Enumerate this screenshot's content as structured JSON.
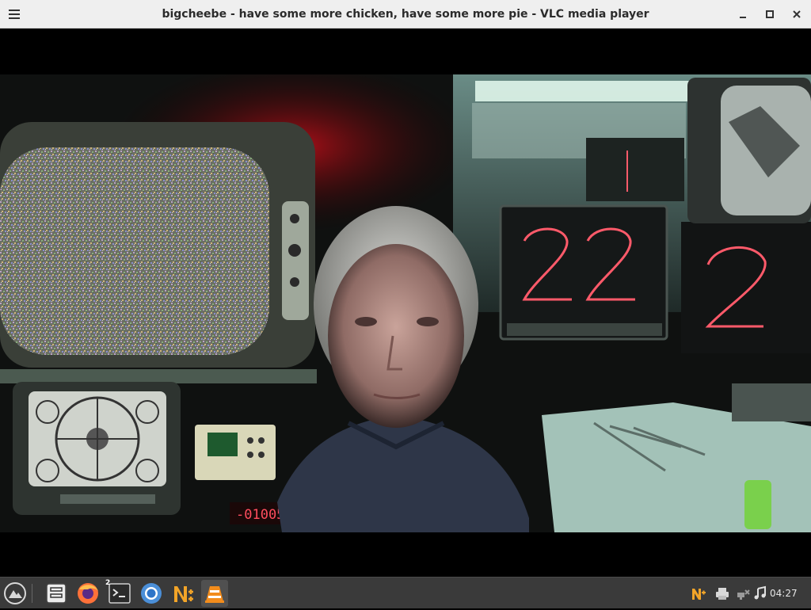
{
  "window": {
    "title": "bigcheebe - have some more chicken, have some more pie - VLC media player",
    "menu_icon": "hamburger-menu-icon",
    "controls": [
      "minimize-icon",
      "maximize-icon",
      "close-icon"
    ]
  },
  "video": {
    "overlay_counter": "-01005"
  },
  "taskbar": {
    "launcher_icon": "app-launcher-icon",
    "apps": [
      {
        "name": "files",
        "icon": "file-manager-icon"
      },
      {
        "name": "firefox",
        "icon": "firefox-icon"
      },
      {
        "name": "terminal",
        "icon": "terminal-icon",
        "badge": "2"
      },
      {
        "name": "chromium",
        "icon": "chromium-icon"
      },
      {
        "name": "notepadqq",
        "icon": "notepadqq-icon"
      },
      {
        "name": "vlc",
        "icon": "vlc-icon",
        "active": true
      }
    ],
    "tray": [
      "notepadqq-tray-icon",
      "printer-icon",
      "network-disconnected-icon",
      "audio-icon"
    ],
    "clock": "04:27"
  },
  "colors": {
    "titlebar_bg": "#efefef",
    "taskbar_bg": "#3a3a3a",
    "vlc_orange": "#f28c1c",
    "nixie_red": "#ff4d5e"
  }
}
